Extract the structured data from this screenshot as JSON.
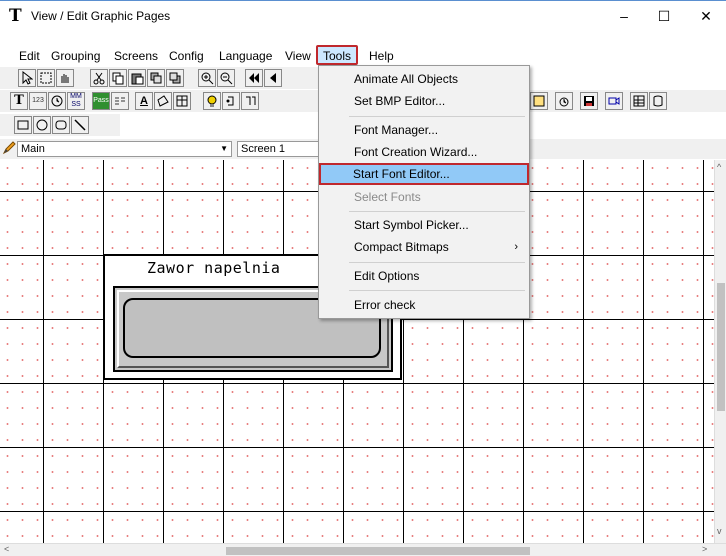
{
  "window": {
    "title": "View / Edit Graphic Pages",
    "minimize": "–",
    "maximize": "☐",
    "close": "✕"
  },
  "menu": [
    "Edit",
    "Grouping",
    "Screens",
    "Config",
    "Language",
    "View",
    "Tools",
    "Help"
  ],
  "toolbar": {
    "row2_text": [
      "T",
      "123",
      "MM SS",
      "Pass",
      "A"
    ],
    "page_combo": "Main",
    "screen_combo": "Screen 1"
  },
  "canvas": {
    "widget_label": "Zawor napelnia"
  },
  "tools_menu": [
    {
      "label": "Animate All Objects",
      "enabled": true
    },
    {
      "label": "Set BMP Editor...",
      "enabled": true
    },
    {
      "label": "Font Manager...",
      "enabled": true
    },
    {
      "label": "Font Creation Wizard...",
      "enabled": true
    },
    {
      "label": "Start Font Editor...",
      "enabled": true,
      "highlighted": true
    },
    {
      "label": "Select Fonts",
      "enabled": false
    },
    {
      "label": "Start Symbol Picker...",
      "enabled": true
    },
    {
      "label": "Compact Bitmaps",
      "enabled": true,
      "submenu": "›"
    },
    {
      "label": "Edit Options",
      "enabled": true
    },
    {
      "label": "Error check",
      "enabled": true
    }
  ],
  "colors": {
    "highlight_outline": "#c0282d",
    "menu_highlight": "#91c9f7",
    "grid_dot": "#e88080"
  }
}
